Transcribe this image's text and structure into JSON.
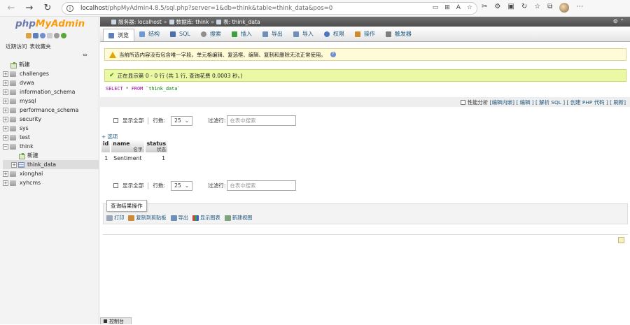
{
  "browser": {
    "url_host": "localhost",
    "url_path": "/phpMyAdmin4.8.5/sql.php?server=1&db=think&table=think_data&pos=0"
  },
  "sidebar": {
    "logo_php": "php",
    "logo_myadmin": "MyAdmin",
    "tab_recent": "近期访问",
    "tab_favorites": "表收藏夹",
    "tree": [
      {
        "label": "新建",
        "kind": "new"
      },
      {
        "label": "challenges",
        "kind": "db"
      },
      {
        "label": "dvwa",
        "kind": "db"
      },
      {
        "label": "information_schema",
        "kind": "db"
      },
      {
        "label": "mysql",
        "kind": "db"
      },
      {
        "label": "performance_schema",
        "kind": "db"
      },
      {
        "label": "security",
        "kind": "db"
      },
      {
        "label": "sys",
        "kind": "db"
      },
      {
        "label": "test",
        "kind": "db"
      },
      {
        "label": "think",
        "kind": "db-open"
      },
      {
        "label": "新建",
        "kind": "new-child"
      },
      {
        "label": "think_data",
        "kind": "table-selected"
      },
      {
        "label": "xionghai",
        "kind": "db"
      },
      {
        "label": "xyhcms",
        "kind": "db"
      }
    ]
  },
  "breadcrumb": {
    "server": "服务器: localhost",
    "database": "数据库: think",
    "table": "表: think_data"
  },
  "tabs": [
    {
      "label": "浏览",
      "color": "#5b7fbf"
    },
    {
      "label": "结构",
      "color": "#6a9bd8"
    },
    {
      "label": "SQL",
      "color": "#4a6fb0"
    },
    {
      "label": "搜索",
      "color": "#8f8f8f"
    },
    {
      "label": "插入",
      "color": "#3f9f3f"
    },
    {
      "label": "导出",
      "color": "#6d8fb8"
    },
    {
      "label": "导入",
      "color": "#6d8fb8"
    },
    {
      "label": "权限",
      "color": "#4a78c0"
    },
    {
      "label": "操作",
      "color": "#d08a2c"
    },
    {
      "label": "触发器",
      "color": "#7d7d7d"
    }
  ],
  "notice": {
    "text": "当前所选内容没有包含唯一字段。单元格编辑、复选框、编辑、复制和删除无法正常使用。"
  },
  "success": {
    "text": "正在显示第 0 - 0 行 (共 1 行, 查询花费 0.0003 秒。)"
  },
  "sql": {
    "select": "SELECT",
    "star": "*",
    "from": "FROM",
    "table": "`think_data`"
  },
  "profiling": {
    "checkbox_label": "性能分析",
    "link_inline_edit": "[编辑内嵌]",
    "link_edit": "[ 编辑 ]",
    "link_explain": "[ 解析 SQL ]",
    "link_php": "[ 创建 PHP 代码 ]",
    "link_refresh": "[ 刷新]"
  },
  "navigation": {
    "show_all": "显示全部",
    "rows_label": "行数:",
    "rows_value": "25",
    "filter_label": "过滤行:",
    "filter_placeholder": "在表中搜索"
  },
  "options_link": "+ 选项",
  "table": {
    "columns": [
      {
        "name": "id",
        "comment": ""
      },
      {
        "name": "name",
        "comment": "名字"
      },
      {
        "name": "status",
        "comment": "状态"
      }
    ],
    "rows": [
      {
        "id": "1",
        "name": "Sentiment",
        "status": "1"
      }
    ]
  },
  "query_ops": {
    "legend": "查询结果操作",
    "print": "打印",
    "copy": "复制到剪贴板",
    "export": "导出",
    "chart": "显示图表",
    "view": "新建视图"
  },
  "console": {
    "label": "控制台"
  }
}
